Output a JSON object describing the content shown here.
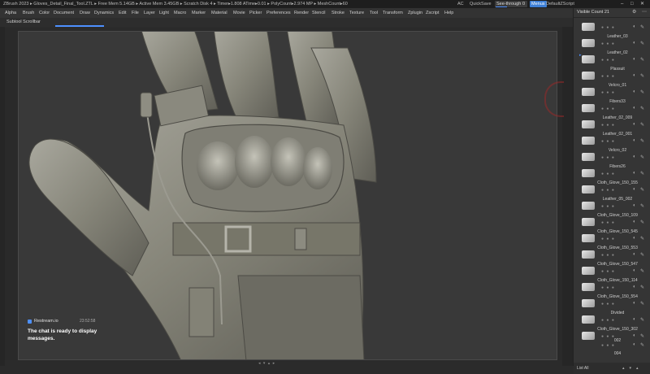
{
  "titlebar": {
    "title": "ZBrush 2023 ▸ Gloves_Detail_Final_Tool.ZTL ▸ Free Mem 5.14GB ▸ Active Mem 3.45GB ▸ Scratch Disk 4 ▸ Timer▸1.808 ATime▸0.01 ▸ PolyCount▸2.974 MP ▸ MeshCount▸60",
    "ac": "AC",
    "quicksave": "QuickSave",
    "see_through": "See-through",
    "see_through_value": "0",
    "menus": "Menus",
    "script": "DefaultZScript"
  },
  "menubar": {
    "items": [
      "Alpha",
      "Brush",
      "Color",
      "Document",
      "Draw",
      "Dynamics",
      "Edit",
      "File",
      "Layer",
      "Light",
      "Macro",
      "Marker",
      "Material",
      "Movie",
      "Picker",
      "Preferences",
      "Render",
      "Stencil",
      "Stroke",
      "Texture",
      "Tool",
      "Transform",
      "Zplugin",
      "Zscript",
      "Help"
    ]
  },
  "subtoolbar": {
    "label": "Subtool Scrollbar"
  },
  "chat": {
    "source": "Restream.io",
    "time": "23:52:58",
    "message": "The chat is ready to display messages."
  },
  "subtool_panel": {
    "visible_count_label": "Visible Count",
    "visible_count": "21",
    "items": [
      {
        "name": ""
      },
      {
        "name": "Leather_03"
      },
      {
        "name": "Leather_02"
      },
      {
        "name": "Plassuit"
      },
      {
        "name": "Velcro_01"
      },
      {
        "name": "Fibers33"
      },
      {
        "name": "Leather_02_009"
      },
      {
        "name": "Leather_02_001"
      },
      {
        "name": "Velcro_02"
      },
      {
        "name": "Fibers26"
      },
      {
        "name": "Cloth_Glove_150_155"
      },
      {
        "name": "Leather_05_002"
      },
      {
        "name": "Cloth_Glove_150_109"
      },
      {
        "name": "Cloth_Glove_150_545"
      },
      {
        "name": "Cloth_Glove_150_553"
      },
      {
        "name": "Cloth_Glove_150_547"
      },
      {
        "name": "Cloth_Glove_150_114"
      },
      {
        "name": "Cloth_Glove_150_554"
      },
      {
        "name": "Divided"
      },
      {
        "name": "Cloth_Glove_150_302"
      },
      {
        "name": "002"
      },
      {
        "name": "004"
      }
    ],
    "bottom_label": "List All"
  }
}
